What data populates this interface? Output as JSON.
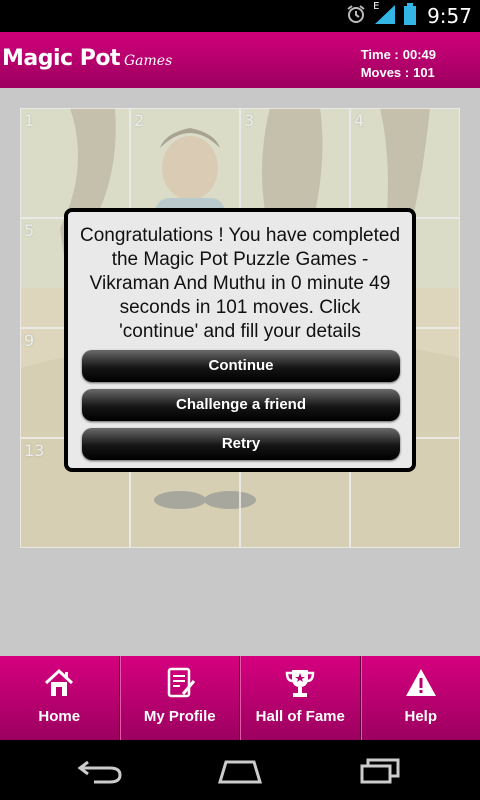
{
  "status_bar": {
    "time": "9:57",
    "network_label": "E",
    "icons": [
      "alarm-icon",
      "signal-icon",
      "battery-icon"
    ]
  },
  "header": {
    "logo_main": "Magic Pot",
    "logo_sub": "Games",
    "time_label": "Time :",
    "time_value": "00:49",
    "moves_label": "Moves :",
    "moves_value": "101"
  },
  "puzzle": {
    "tile_numbers": [
      "1",
      "2",
      "3",
      "4",
      "5",
      "9",
      "13"
    ]
  },
  "dialog": {
    "message": "Congratulations ! You have completed the Magic Pot Puzzle Games - Vikraman And Muthu in 0 minute 49 seconds in 101 moves. Click 'continue' and fill your details",
    "continue_label": "Continue",
    "challenge_label": "Challenge a friend",
    "retry_label": "Retry"
  },
  "tabs": [
    {
      "label": "Home",
      "icon": "home-icon"
    },
    {
      "label": "My Profile",
      "icon": "profile-icon"
    },
    {
      "label": "Hall of Fame",
      "icon": "trophy-icon"
    },
    {
      "label": "Help",
      "icon": "warning-icon"
    }
  ],
  "colors": {
    "brand": "#c8007a",
    "status_accent": "#33b5e5"
  }
}
